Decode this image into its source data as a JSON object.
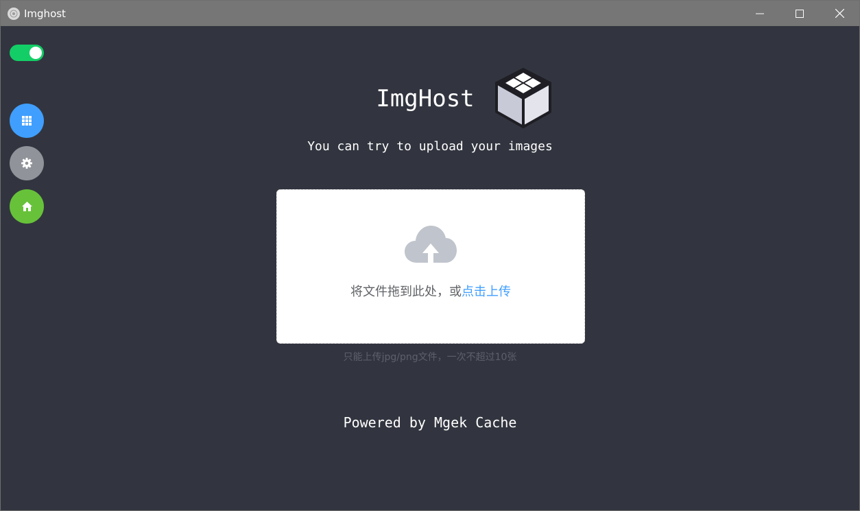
{
  "window": {
    "title": "Imghost",
    "controls": [
      "minimize",
      "maximize",
      "close"
    ]
  },
  "sidebar": {
    "toggle": {
      "state": "on",
      "color": "#13ce66"
    },
    "buttons": [
      {
        "icon": "grid-icon",
        "color": "#409eff"
      },
      {
        "icon": "gear-icon",
        "color": "#909399"
      },
      {
        "icon": "home-icon",
        "color": "#67c23a"
      }
    ]
  },
  "header": {
    "title": "ImgHost",
    "logo_icon": "cube-icon",
    "subtitle": "You can try to upload your images"
  },
  "upload": {
    "icon": "cloud-upload-icon",
    "text_prefix": "将文件拖到此处，或",
    "link_text": "点击上传",
    "tip": "只能上传jpg/png文件，一次不超过10张"
  },
  "footer": {
    "text": "Powered by Mgek Cache"
  },
  "colors": {
    "background": "#32353f",
    "titlebar": "#767676",
    "link": "#409eff"
  }
}
